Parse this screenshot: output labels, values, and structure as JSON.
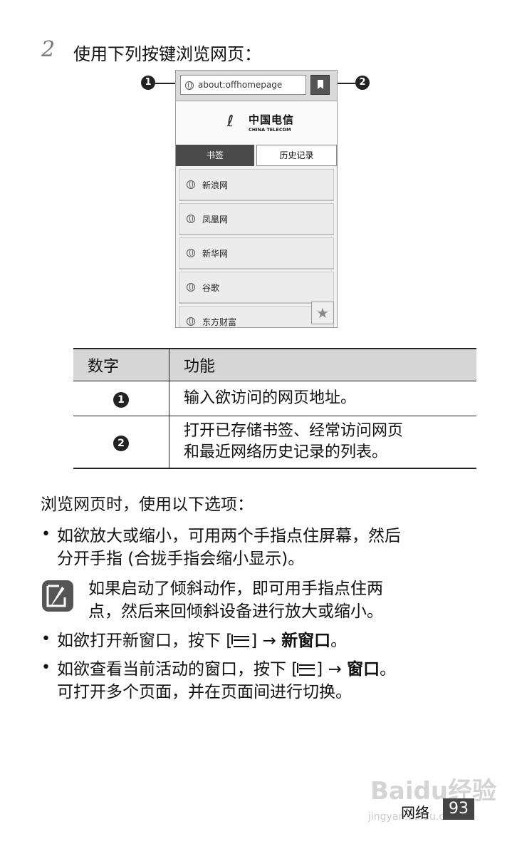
{
  "step": {
    "number": "2",
    "text": "使用下列按键浏览网页："
  },
  "browser": {
    "url": "about:offhomepage",
    "logo_cn": "中国电信",
    "logo_en": "CHINA TELECOM",
    "tabs": [
      "书签",
      "历史记录"
    ],
    "bookmarks": [
      "新浪网",
      "凤凰网",
      "新华网",
      "谷歌",
      "东方财富"
    ],
    "callouts": [
      "1",
      "2"
    ]
  },
  "table": {
    "headers": [
      "数字",
      "功能"
    ],
    "rows": [
      {
        "num": "1",
        "func": "输入欲访问的网页地址。"
      },
      {
        "num": "2",
        "func_line1": "打开已存储书签、经常访问网页",
        "func_line2": "和最近网络历史记录的列表。"
      }
    ]
  },
  "intro": "浏览网页时，使用以下选项：",
  "bullet1": {
    "line1": "如欲放大或缩小，可用两个手指点住屏幕，然后",
    "line2": "分开手指 (合拢手指会缩小显示)。"
  },
  "note": {
    "line1": "如果启动了倾斜动作，即可用手指点住两",
    "line2": "点，然后来回倾斜设备进行放大或缩小。"
  },
  "bullet2": {
    "pre": "如欲打开新窗口，按下 [",
    "post": "] → ",
    "bold": "新窗口",
    "end": "。"
  },
  "bullet3": {
    "pre": "如欲查看当前活动的窗口，按下 [",
    "post": "] → ",
    "bold": "窗口",
    "end": "。",
    "line2": "可打开多个页面，并在页面间进行切换。"
  },
  "footer": {
    "label": "网络",
    "page": "93"
  },
  "watermark": {
    "text": "Baidu经验",
    "url": "jingyan.baidu.com"
  },
  "icons": [
    "globe-icon",
    "bookmark-icon",
    "star-icon",
    "note-icon",
    "menu-key-icon"
  ]
}
